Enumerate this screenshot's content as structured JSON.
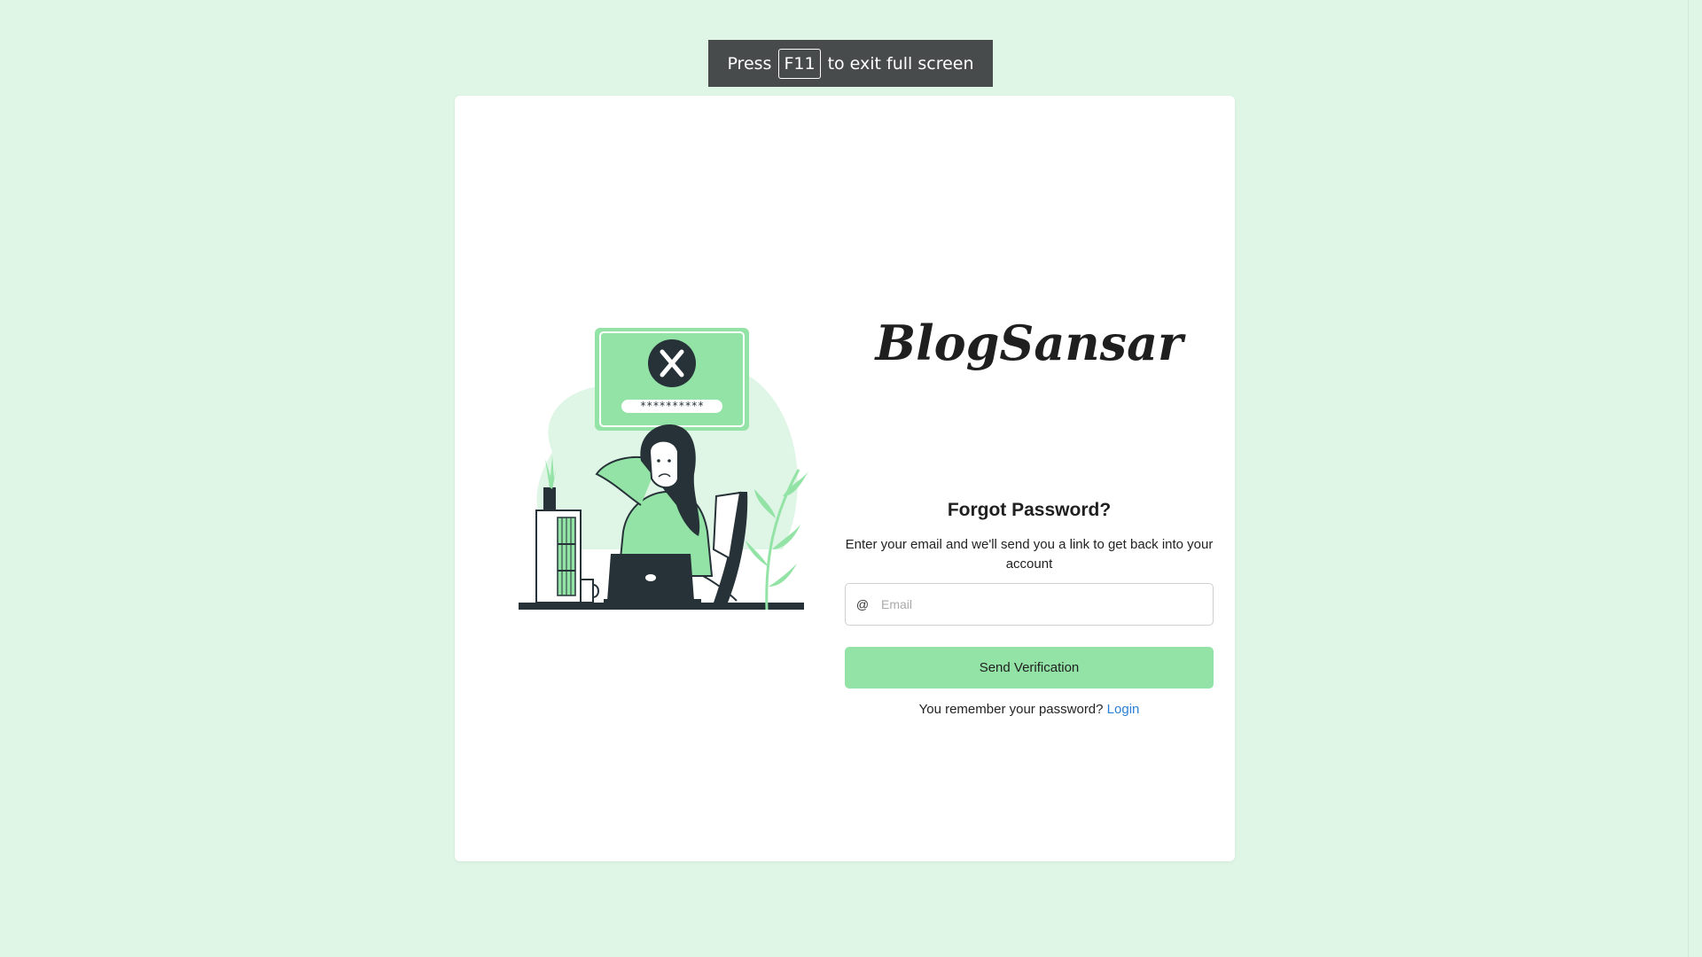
{
  "fullscreen_notice": {
    "press": "Press",
    "key": "F11",
    "suffix": "to exit full screen"
  },
  "brand": {
    "logo_text": "BlogSansar"
  },
  "illustration": {
    "password_mask": "**********",
    "icon": "x-icon"
  },
  "form": {
    "title": "Forgot Password?",
    "subtitle": "Enter your email and we'll send you a link to get back into your account",
    "email_icon": "@",
    "email_placeholder": "Email",
    "email_value": "",
    "submit_label": "Send Verification",
    "remember_text": "You remember your password?",
    "login_link": "Login"
  },
  "colors": {
    "page_background": "#dff5e6",
    "accent_green": "#93e3a6",
    "link_blue": "#2a7fd4",
    "notice_background": "#474b4b"
  }
}
